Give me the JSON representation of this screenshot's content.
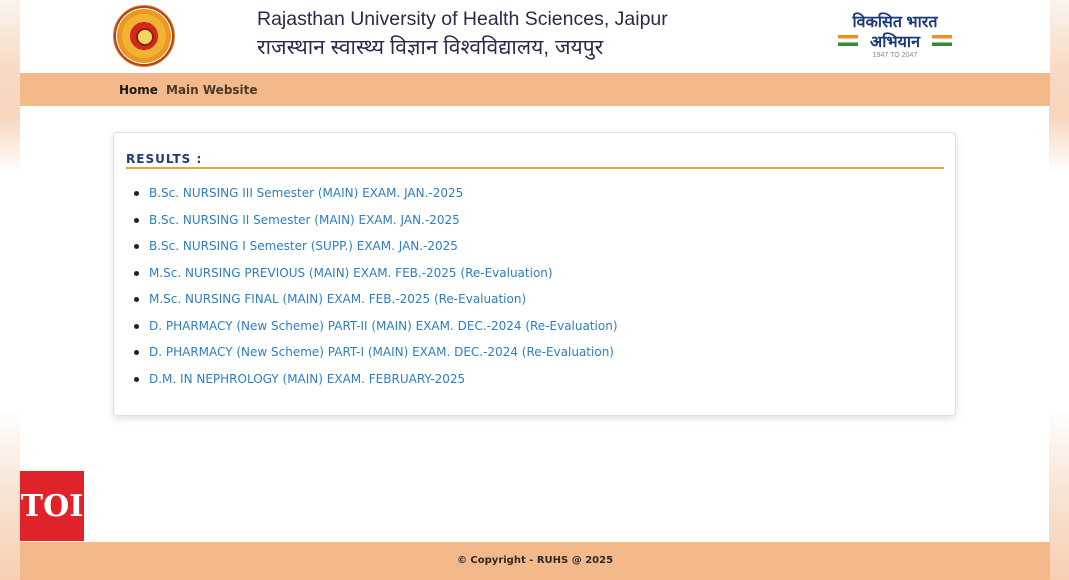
{
  "header": {
    "title_en": "Rajasthan University of Health Sciences, Jaipur",
    "title_hi": "राजस्थान स्वास्थ्य विज्ञान विश्वविद्यालय, जयपुर",
    "campaign_line1": "विकसित भारत",
    "campaign_line2": "अभियान",
    "campaign_years": "1947 TO 2047"
  },
  "nav": {
    "items": [
      {
        "label": "Home"
      },
      {
        "label": "Main Website"
      }
    ]
  },
  "results": {
    "heading": "RESULTS :",
    "items": [
      {
        "label": "B.Sc. NURSING III Semester (MAIN) EXAM. JAN.-2025"
      },
      {
        "label": "B.Sc. NURSING II Semester (MAIN) EXAM. JAN.-2025"
      },
      {
        "label": "B.Sc. NURSING I Semester (SUPP.) EXAM. JAN.-2025"
      },
      {
        "label": "M.Sc. NURSING PREVIOUS (MAIN) EXAM. FEB.-2025 (Re-Evaluation)"
      },
      {
        "label": "M.Sc. NURSING FINAL (MAIN) EXAM. FEB.-2025 (Re-Evaluation)"
      },
      {
        "label": "D. PHARMACY (New Scheme) PART-II (MAIN) EXAM. DEC.-2024 (Re-Evaluation)"
      },
      {
        "label": "D. PHARMACY (New Scheme) PART-I (MAIN) EXAM. DEC.-2024 (Re-Evaluation)"
      },
      {
        "label": "D.M. IN NEPHROLOGY (MAIN) EXAM. FEBRUARY-2025"
      }
    ]
  },
  "watermark": {
    "label": "TOI"
  },
  "footer": {
    "copyright": "© Copyright - RUHS @ 2025"
  },
  "colors": {
    "nav_bg": "#f4b98a",
    "link": "#2d7ec4",
    "heading": "#1f3d6e",
    "rule": "#e8a43a",
    "toi_red": "#e0232b"
  }
}
